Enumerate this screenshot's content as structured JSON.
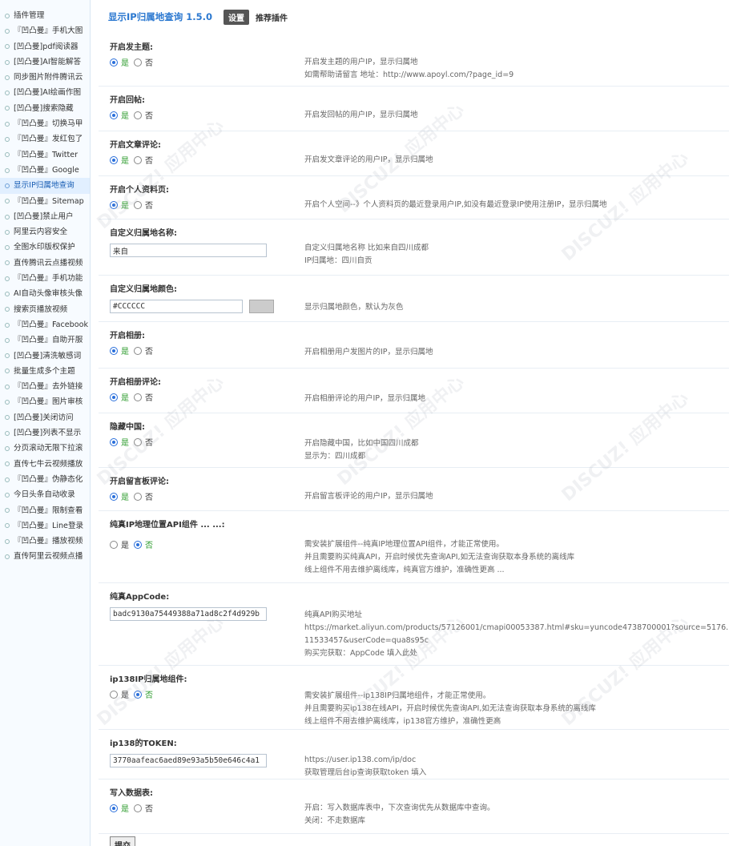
{
  "sidebar": {
    "items": [
      {
        "label": "插件管理"
      },
      {
        "label": "『凹凸曼』手机大图"
      },
      {
        "label": "[凹凸曼]pdf阅读器"
      },
      {
        "label": "[凹凸曼]AI智能解答"
      },
      {
        "label": "同步图片附件腾讯云"
      },
      {
        "label": "[凹凸曼]AI绘画作图"
      },
      {
        "label": "[凹凸曼]搜索隐藏"
      },
      {
        "label": "『凹凸曼』切换马甲"
      },
      {
        "label": "『凹凸曼』发红包了"
      },
      {
        "label": "『凹凸曼』Twitter"
      },
      {
        "label": "『凹凸曼』Google"
      },
      {
        "label": "显示IP归属地查询"
      },
      {
        "label": "『凹凸曼』Sitemap"
      },
      {
        "label": "[凹凸曼]禁止用户"
      },
      {
        "label": "阿里云内容安全"
      },
      {
        "label": "全图水印版权保护"
      },
      {
        "label": "直传腾讯云点播视频"
      },
      {
        "label": "『凹凸曼』手机功能"
      },
      {
        "label": "AI自动头像审核头像"
      },
      {
        "label": "搜索页播放视频"
      },
      {
        "label": "『凹凸曼』Facebook"
      },
      {
        "label": "『凹凸曼』自助开服"
      },
      {
        "label": "[凹凸曼]清洗敏感词"
      },
      {
        "label": "批量生成多个主题"
      },
      {
        "label": "『凹凸曼』去外链接"
      },
      {
        "label": "『凹凸曼』图片审核"
      },
      {
        "label": "[凹凸曼]关闭访问"
      },
      {
        "label": "[凹凸曼]列表不显示"
      },
      {
        "label": "分页滚动无限下拉滚"
      },
      {
        "label": "直传七牛云视频播放"
      },
      {
        "label": "『凹凸曼』伪静态化"
      },
      {
        "label": "今日头条自动收录"
      },
      {
        "label": "『凹凸曼』限制查看"
      },
      {
        "label": "『凹凸曼』Line登录"
      },
      {
        "label": "『凹凸曼』播放视频"
      },
      {
        "label": "直传阿里云视频点播"
      }
    ]
  },
  "header": {
    "title": "显示IP归属地查询 1.5.0",
    "setting_label": "设置",
    "recommend_label": "推荐插件"
  },
  "radio_labels": {
    "yes": "是",
    "no": "否"
  },
  "settings": [
    {
      "label": "开启发主题:",
      "value": "yes",
      "desc": [
        "开启发主题的用户IP，显示归属地",
        "如需帮助请留言 地址：http://www.apoyl.com/?page_id=9"
      ]
    },
    {
      "label": "开启回帖:",
      "value": "yes",
      "desc": [
        "开启发回帖的用户IP，显示归属地"
      ]
    },
    {
      "label": "开启文章评论:",
      "value": "yes",
      "desc": [
        "开启发文章评论的用户IP，显示归属地"
      ]
    },
    {
      "label": "开启个人资料页:",
      "value": "yes",
      "desc": [
        "开启个人空间--》个人资料页的最近登录用户IP,如没有最近登录IP使用注册IP，显示归属地"
      ]
    },
    {
      "label": "自定义归属地名称:",
      "input": "来自",
      "desc": [
        "自定义归属地名称 比如来自四川成都",
        "IP归属地：四川自贡"
      ]
    },
    {
      "label": "自定义归属地颜色:",
      "input": "#CCCCCC",
      "swatch": "#cccccc",
      "desc": [
        "显示归属地颜色，默认为灰色"
      ]
    },
    {
      "label": "开启相册:",
      "value": "yes",
      "desc": [
        "开启相册用户发图片的IP，显示归属地"
      ]
    },
    {
      "label": "开启相册评论:",
      "value": "yes",
      "desc": [
        "开启相册评论的用户IP，显示归属地"
      ]
    },
    {
      "label": "隐藏中国:",
      "value": "yes",
      "desc": [
        "开启隐藏中国，比如中国四川成都",
        "显示为：四川成都"
      ]
    },
    {
      "label": "开启留言板评论:",
      "value": "yes",
      "desc": [
        "开启留言板评论的用户IP，显示归属地"
      ]
    },
    {
      "label": "纯真IP地理位置API组件 ... ...:",
      "value": "no",
      "desc": [
        "需安装扩展组件--纯真IP地理位置API组件，才能正常使用。",
        "并且需要购买纯真API，开启时候优先查询API,如无法查询获取本身系统的离线库",
        "线上组件不用去维护离线库，纯真官方维护，准确性更高 ..."
      ]
    },
    {
      "label": "纯真AppCode:",
      "input": "badc9130a75449388a71ad8c2f4d929b",
      "desc": [
        "纯真API购买地址",
        "https://market.aliyun.com/products/57126001/cmapi00053387.html#sku=yuncode4738700001?source=5176.",
        "11533457&userCode=qua8s95c",
        "购买完获取：AppCode 填入此处"
      ]
    },
    {
      "label": "ip138IP归属地组件:",
      "value": "no",
      "desc": [
        "需安装扩展组件--ip138IP归属地组件，才能正常使用。",
        "并且需要购买ip138在线API，开启时候优先查询API,如无法查询获取本身系统的离线库",
        "线上组件不用去维护离线库，ip138官方维护，准确性更高"
      ]
    },
    {
      "label": "ip138的TOKEN:",
      "input": "3770aafeac6aed89e93a5b50e646c4a1",
      "desc": [
        "https://user.ip138.com/ip/doc",
        "获取管理后台ip查询获取token 填入"
      ]
    },
    {
      "label": "写入数据表:",
      "value": "yes",
      "desc": [
        "开启：写入数据库表中，下次查询优先从数据库中查询。",
        "关闭：不走数据库"
      ]
    }
  ],
  "submit_label": "提交"
}
